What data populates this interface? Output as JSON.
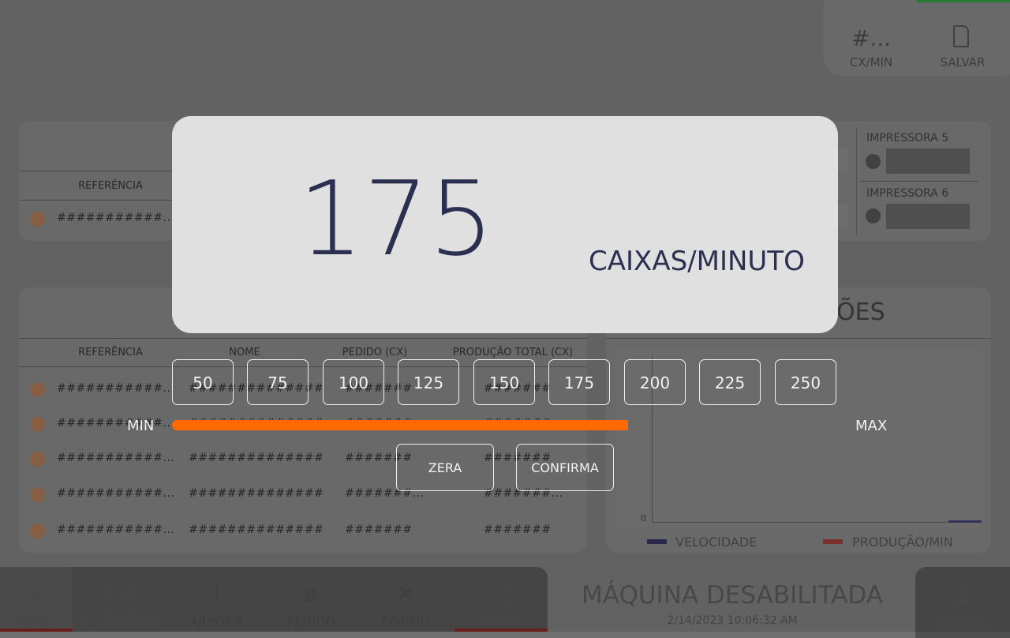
{
  "top_right": {
    "speed_value": "#...",
    "speed_label": "CX/MIN",
    "save_label": "SALVAR"
  },
  "printers": [
    {
      "label": "IMPRESSORA 5"
    },
    {
      "label": "IMPRESSORA 6"
    }
  ],
  "top_table": {
    "header_referencia": "REFERÊNCIA",
    "row_ref": "###########..."
  },
  "main_table": {
    "headers": [
      "REFERÊNCIA",
      "NOME",
      "PEDIDO (CX)",
      "PRODUÇÃO TOTAL (CX)"
    ],
    "rows": [
      {
        "ref": "###########...",
        "nome": "##############",
        "pedido": "#######",
        "producao": "#######"
      },
      {
        "ref": "###########...",
        "nome": "##############",
        "pedido": "#######",
        "producao": "#######"
      },
      {
        "ref": "###########...",
        "nome": "##############",
        "pedido": "#######",
        "producao": "#######"
      },
      {
        "ref": "###########...",
        "nome": "##############",
        "pedido": "#######...",
        "producao": "#######..."
      },
      {
        "ref": "###########...",
        "nome": "##############",
        "pedido": "#######",
        "producao": "#######"
      }
    ]
  },
  "chart_panel": {
    "title_fragment": "ÕES",
    "axis_zero": "0",
    "legend_velocidade": "VELOCIDADE",
    "legend_producao": "PRODUÇÃO/MIN",
    "color_velocidade": "#2e2e5a",
    "color_producao": "#8a3a30"
  },
  "nav": {
    "inicio": "INICIO",
    "comandos": "COMANDOS",
    "ajustes": "AJUSTES",
    "pedido": "PEDIDO",
    "config": "CONFIG",
    "ajuda": "AJUDA",
    "alarmes": "ALARMES"
  },
  "status": {
    "title": "MÁQUINA DESABILITADA",
    "datetime": "2/14/2023 10:06:32 AM"
  },
  "modal": {
    "value": "175",
    "unit": "CAIXAS/MINUTO",
    "options": [
      "50",
      "75",
      "100",
      "125",
      "150",
      "175",
      "200",
      "225",
      "250"
    ],
    "selected": "175",
    "min_label": "MIN",
    "max_label": "MAX",
    "slider_fraction": 0.5,
    "slider_color": "#ff6a00",
    "zera_label": "ZERA",
    "confirma_label": "CONFIRMA"
  }
}
